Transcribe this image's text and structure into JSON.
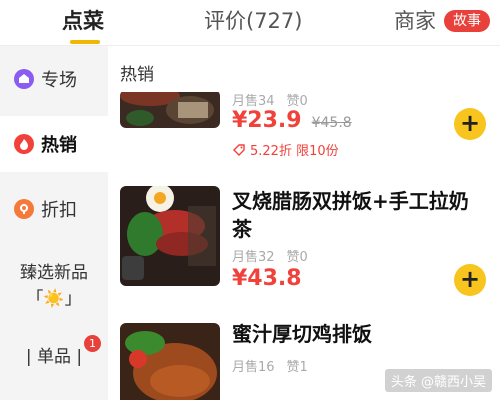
{
  "tabs": [
    {
      "label": "点菜",
      "active": true
    },
    {
      "label": "评价(727)",
      "active": false
    },
    {
      "label": "商家",
      "active": false
    }
  ],
  "tab_badge": "故事",
  "sidebar": {
    "items": [
      {
        "label": "专场",
        "icon": "special-icon",
        "color": "#8a5cf0"
      },
      {
        "label": "热销",
        "icon": "flame-icon",
        "color": "#f0413b"
      },
      {
        "label": "折扣",
        "icon": "discount-icon",
        "color": "#f5793b"
      }
    ],
    "new_products": "臻选新品",
    "new_products_emoji": "「☀️」",
    "single": "| 单品 |",
    "single_badge": "1"
  },
  "main": {
    "section_title": "热销",
    "items": [
      {
        "meta": [
          "月售34",
          "赞0"
        ],
        "price": "¥23.9",
        "original_price": "¥45.8",
        "discount": "5.22折 限10份",
        "add": "+"
      },
      {
        "name": "叉烧腊肠双拼饭+手工拉奶茶",
        "meta": [
          "月售32",
          "赞0"
        ],
        "price": "¥43.8",
        "add": "+"
      },
      {
        "name": "蜜汁厚切鸡排饭",
        "meta": [
          "月售16",
          "赞1"
        ]
      }
    ]
  },
  "watermark": "头条 @赣西小吴",
  "colors": {
    "accent": "#f2b705",
    "price": "#f0413b",
    "add_button": "#f7c51e",
    "badge": "#e8413b"
  }
}
